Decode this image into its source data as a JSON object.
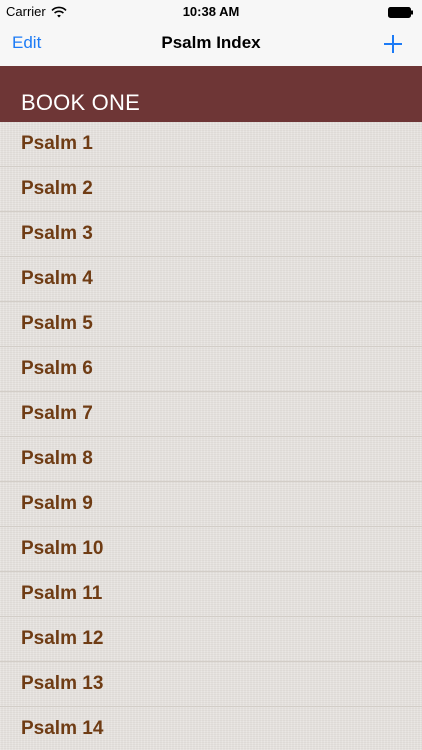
{
  "status_bar": {
    "carrier": "Carrier",
    "time": "10:38 AM",
    "wifi_icon": "wifi-icon",
    "battery_icon": "battery-icon"
  },
  "nav": {
    "edit_label": "Edit",
    "title": "Psalm Index",
    "add_icon": "plus-icon",
    "accent_color": "#1c7bf6"
  },
  "section": {
    "title": "BOOK ONE",
    "header_color": "#6e3636"
  },
  "rows": [
    "Psalm 1",
    "Psalm 2",
    "Psalm 3",
    "Psalm 4",
    "Psalm 5",
    "Psalm 6",
    "Psalm 7",
    "Psalm 8",
    "Psalm 9",
    "Psalm 10",
    "Psalm 11",
    "Psalm 12",
    "Psalm 13",
    "Psalm 14"
  ]
}
